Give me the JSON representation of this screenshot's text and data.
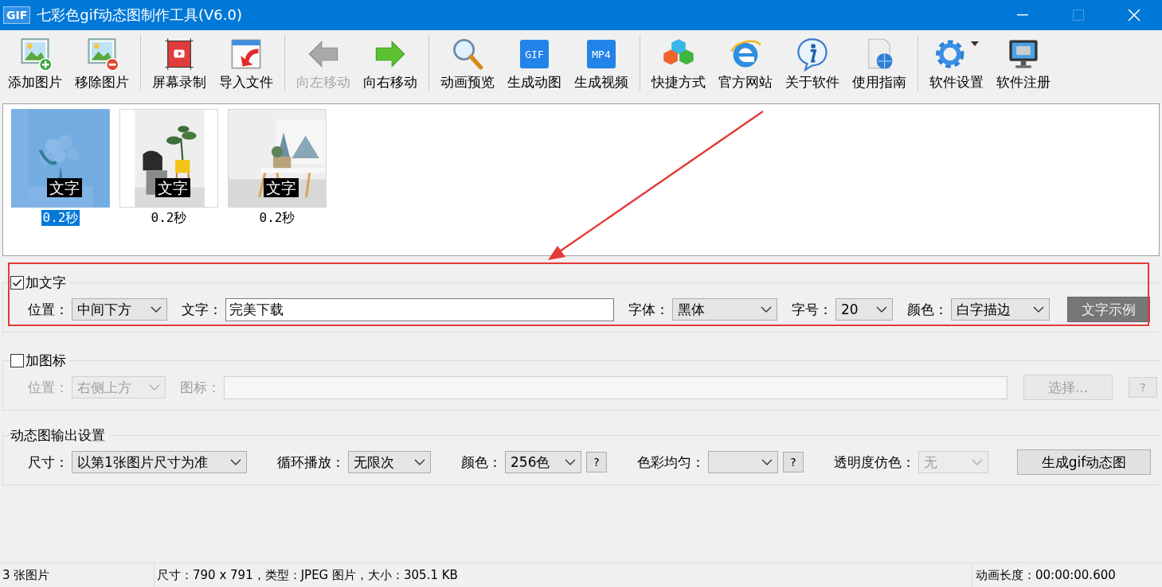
{
  "window": {
    "icon_text": "GIF",
    "title": "七彩色gif动态图制作工具(V6.0)"
  },
  "toolbar": [
    [
      {
        "label": "添加图片",
        "disabled": false
      },
      {
        "label": "移除图片",
        "disabled": false
      }
    ],
    [
      {
        "label": "屏幕录制",
        "disabled": false
      },
      {
        "label": "导入文件",
        "disabled": false
      }
    ],
    [
      {
        "label": "向左移动",
        "disabled": true
      },
      {
        "label": "向右移动",
        "disabled": false
      }
    ],
    [
      {
        "label": "动画预览",
        "disabled": false
      },
      {
        "label": "生成动图",
        "badge": "GIF",
        "disabled": false
      },
      {
        "label": "生成视频",
        "badge": "MP4",
        "disabled": false
      }
    ],
    [
      {
        "label": "快捷方式",
        "disabled": false
      },
      {
        "label": "官方网站",
        "disabled": false
      },
      {
        "label": "关于软件",
        "disabled": false
      },
      {
        "label": "使用指南",
        "disabled": false
      }
    ],
    [
      {
        "label": "软件设置",
        "dropdown": true,
        "disabled": false
      },
      {
        "label": "软件注册",
        "dropdown": false,
        "disabled": false
      }
    ]
  ],
  "frames": [
    {
      "kind": "picture",
      "overlay_text": "文字",
      "duration": "0.2秒",
      "selected": true
    },
    {
      "kind": "picture",
      "overlay_text": "文字",
      "duration": "0.2秒",
      "selected": false
    },
    {
      "kind": "picture",
      "overlay_text": "文字",
      "duration": "0.2秒",
      "selected": false
    }
  ],
  "annotation": {
    "arrow": true
  },
  "sections": [
    {
      "kind": "checkbox",
      "title": "加文字",
      "checked": true,
      "highlighted": true,
      "disabled": false,
      "fields": [
        {
          "kind": "select",
          "label": "位置：",
          "value": "中间下方"
        },
        {
          "kind": "input",
          "label": "文字：",
          "value": "完美下载"
        },
        {
          "kind": "select",
          "label": "字体：",
          "value": "黑体"
        },
        {
          "kind": "select",
          "label": "字号：",
          "value": "20"
        },
        {
          "kind": "select",
          "label": "颜色：",
          "value": "白字描边"
        },
        {
          "kind": "dark-button",
          "value": "文字示例"
        }
      ]
    },
    {
      "kind": "checkbox",
      "title": "加图标",
      "checked": false,
      "highlighted": false,
      "disabled": true,
      "fields": [
        {
          "kind": "select",
          "label": "位置：",
          "value": "右侧上方"
        },
        {
          "kind": "input",
          "label": "图标："
        },
        {
          "kind": "button",
          "value": "选择..."
        },
        {
          "kind": "help",
          "value": "?"
        }
      ]
    },
    {
      "kind": "plain",
      "title": "动态图输出设置",
      "highlighted": false,
      "disabled": false,
      "fields": [
        {
          "kind": "select",
          "label": "尺寸：",
          "value": "以第1张图片尺寸为准"
        },
        {
          "kind": "select",
          "label": "循环播放：",
          "value": "无限次"
        },
        {
          "kind": "select",
          "label": "颜色：",
          "value": "256色"
        },
        {
          "kind": "help",
          "value": "?"
        },
        {
          "kind": "select",
          "label": "色彩均匀："
        },
        {
          "kind": "help",
          "value": "?"
        },
        {
          "kind": "select",
          "label": "透明度仿色：",
          "value": "无",
          "disabled": true
        },
        {
          "kind": "button",
          "value": "生成gif动态图"
        }
      ]
    }
  ],
  "status_bar": [
    "3 张图片",
    "尺寸：790 x 791，类型：JPEG 图片，大小：305.1 KB",
    "动画长度：00:00:00.600"
  ]
}
